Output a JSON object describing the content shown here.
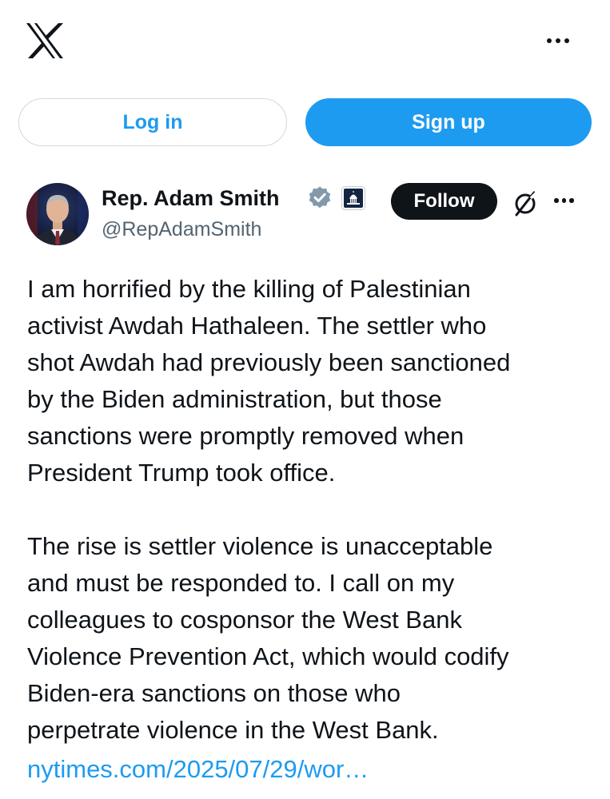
{
  "header": {
    "logo_icon": "x-logo-icon",
    "more_icon": "more-horizontal-icon"
  },
  "auth": {
    "login_label": "Log in",
    "signup_label": "Sign up"
  },
  "tweet": {
    "author": {
      "display_name": "Rep. Adam Smith",
      "handle": "@RepAdamSmith",
      "verified_icon": "verified-badge-icon",
      "affiliation_icon": "us-capitol-icon"
    },
    "follow_label": "Follow",
    "grok_icon": "grok-icon",
    "more_icon": "more-horizontal-icon",
    "text": "I am horrified by the killing of Palestinian\nactivist Awdah Hathaleen. The settler who\nshot Awdah had previously been sanctioned\nby the Biden administration, but those\nsanctions were promptly removed when\nPresident Trump took office.\n\nThe rise is settler violence is unacceptable\nand must be responded to. I call on my\ncolleagues to cosponsor the West Bank\nViolence Prevention Act, which would codify\nBiden-era sanctions on those who\nperpetrate violence in the West Bank.",
    "link": "nytimes.com/2025/07/29/wor…"
  },
  "colors": {
    "accent": "#1d9bf0",
    "text_primary": "#0f1419",
    "text_secondary": "#536471",
    "border": "#cfd9de"
  }
}
